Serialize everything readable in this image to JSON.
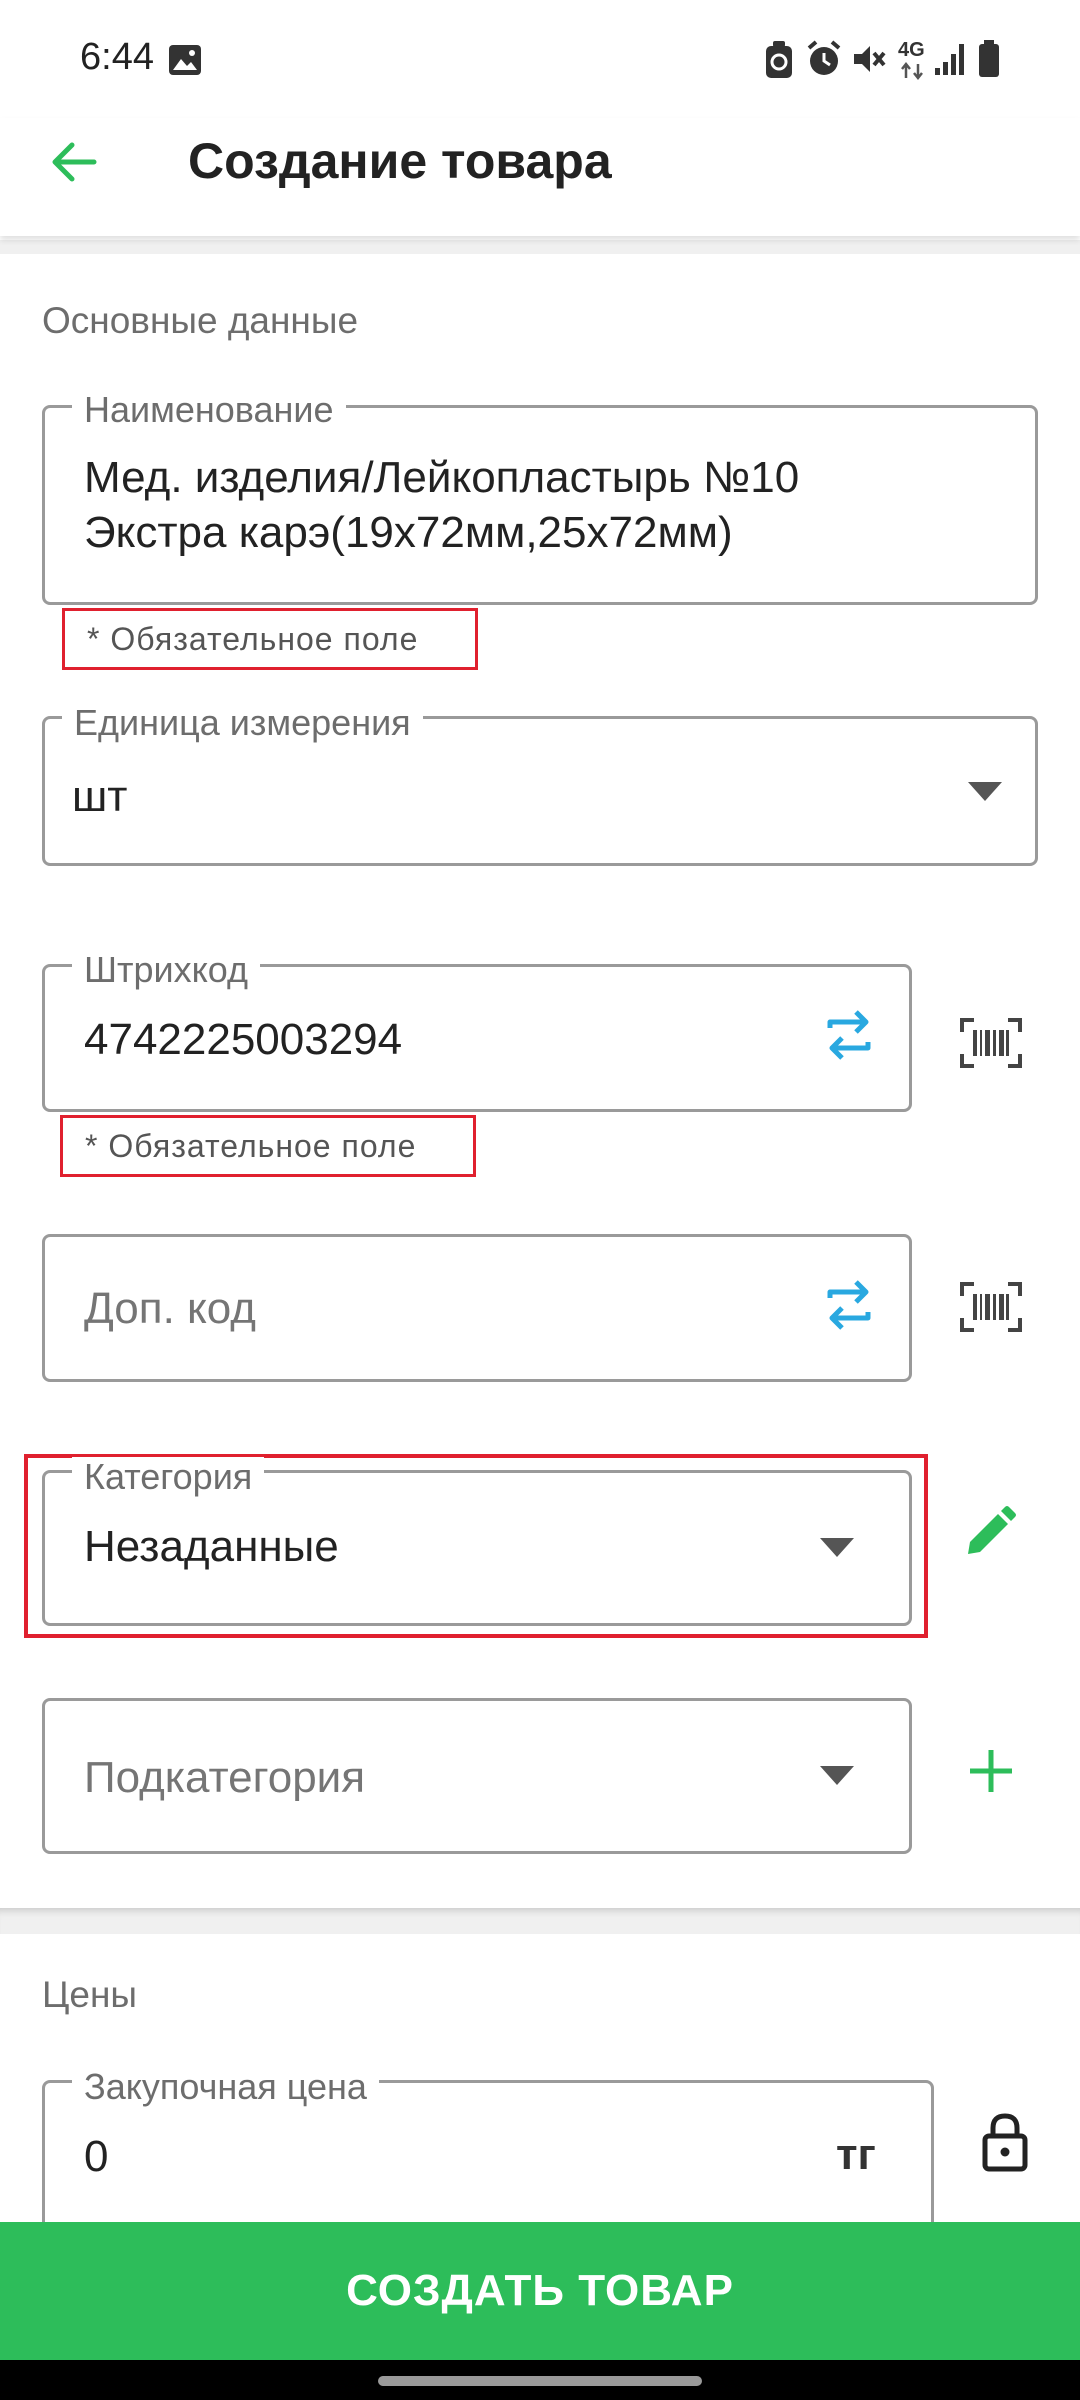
{
  "status_bar": {
    "time": "6:44",
    "icons": [
      "image-icon",
      "data-saver-icon",
      "alarm-icon",
      "mute-icon",
      "4g-icon",
      "signal-icon",
      "battery-icon"
    ],
    "network": "4G"
  },
  "app_bar": {
    "back_icon": "arrow-left-icon",
    "title": "Создание товара"
  },
  "basic_section": {
    "label": "Основные данные",
    "name_field": {
      "label": "Наименование",
      "value_line1": "Мед. изделия/Лейкопластырь №10",
      "value_line2": "Экстра карэ(19x72мм,25x72мм)",
      "helper": "* Обязательное поле"
    },
    "unit_field": {
      "label": "Единица измерения",
      "value": "шт"
    },
    "barcode_field": {
      "label": "Штрихкод",
      "value": "4742225003294",
      "helper": "* Обязательное поле"
    },
    "extra_code_field": {
      "placeholder": "Доп. код"
    },
    "category_field": {
      "label": "Категория",
      "value": "Незаданные"
    },
    "subcategory_field": {
      "placeholder": "Подкатегория"
    }
  },
  "prices_section": {
    "label": "Цены",
    "purchase_price": {
      "label": "Закупочная цена",
      "value": "0",
      "currency": "тг"
    }
  },
  "create_button": "СОЗДАТЬ ТОВАР",
  "colors": {
    "accent_green": "#2dbd5a",
    "swap_blue": "#29a8e0",
    "error_red": "#e0202e"
  }
}
